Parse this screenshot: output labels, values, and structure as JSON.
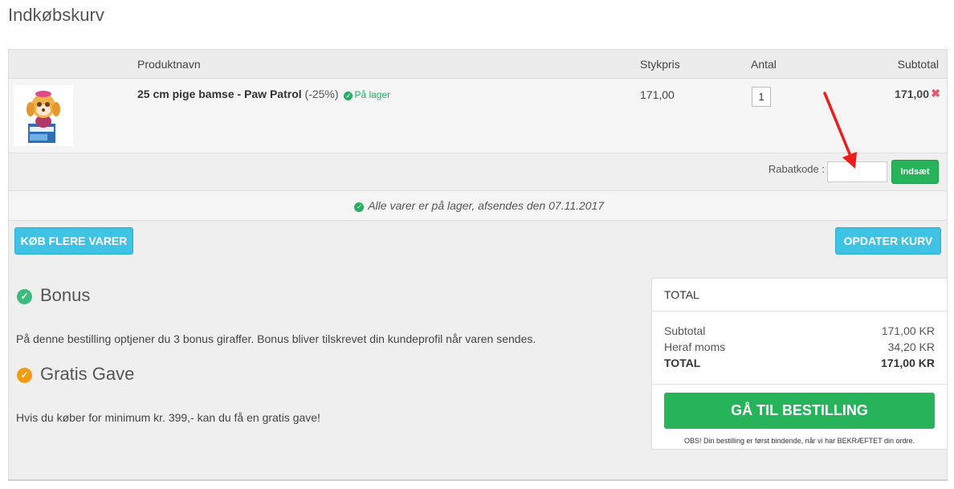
{
  "page": {
    "title": "Indkøbskurv"
  },
  "table": {
    "headers": {
      "product": "Produktnavn",
      "unit_price": "Stykpris",
      "quantity": "Antal",
      "subtotal": "Subtotal"
    },
    "items": [
      {
        "name": "25 cm pige bamse - Paw Patrol",
        "discount": "(-25%)",
        "stock": "På lager",
        "unit_price": "171,00",
        "quantity": "1",
        "subtotal": "171,00",
        "remove_icon": "close-icon"
      }
    ]
  },
  "coupon": {
    "label": "Rabatkode :",
    "value": "",
    "button": "Indsæt"
  },
  "stock_notice": "Alle varer er på lager, afsendes den 07.11.2017",
  "actions": {
    "more_items": "KØB FLERE VARER",
    "update_cart": "OPDATER KURV"
  },
  "bonus": {
    "title": "Bonus",
    "icon": "check-circle-icon",
    "color": "#3dbb7e",
    "text": "På denne bestilling optjener du 3 bonus giraffer. Bonus bliver tilskrevet din kundeprofil når varen sendes."
  },
  "gift": {
    "title": "Gratis Gave",
    "icon": "check-circle-icon",
    "color": "#f39c12",
    "text": "Hvis du køber for minimum kr. 399,- kan du få en gratis gave!"
  },
  "totals": {
    "heading": "TOTAL",
    "rows": [
      {
        "label": "Subtotal",
        "value": "171,00 KR"
      },
      {
        "label": "Heraf moms",
        "value": "34,20 KR"
      },
      {
        "label": "TOTAL",
        "value": "171,00 KR"
      }
    ],
    "checkout_button": "GÅ TIL BESTILLING",
    "note": "OBS! Din bestilling er først bindende, når vi har BEKRÆFTET din ordre."
  },
  "colors": {
    "accent_green": "#27b35a",
    "accent_cyan": "#3fc3e4",
    "remove_red": "#e8566b"
  }
}
